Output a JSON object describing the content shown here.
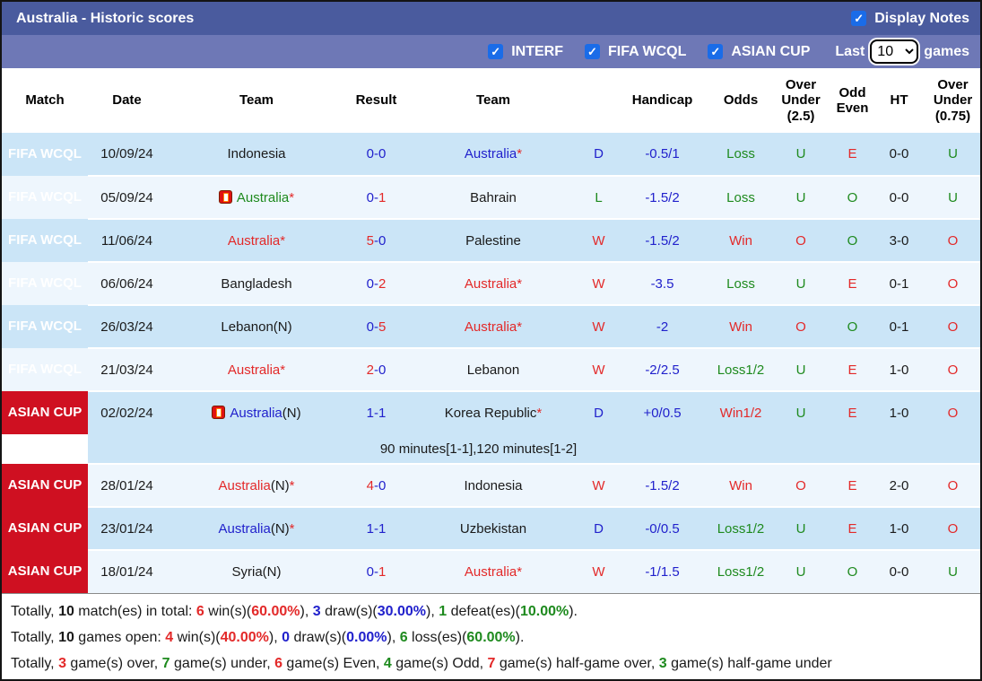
{
  "palette": {
    "red": "#e32929",
    "green": "#1e8a1e",
    "blue": "#2121cc",
    "black": "#1a1a1a"
  },
  "title_bar": {
    "title": "Australia - Historic scores",
    "display_notes": "Display Notes"
  },
  "filter_bar": {
    "interf": "INTERF",
    "fifa": "FIFA WCQL",
    "asian": "ASIAN CUP",
    "last": "Last",
    "games": "games",
    "count": "10"
  },
  "table": {
    "headers": [
      "Match",
      "Date",
      "Team",
      "Result",
      "Team",
      "",
      "Handicap",
      "Odds",
      "Over Under (2.5)",
      "Odd Even",
      "HT",
      "Over Under (0.75)"
    ],
    "rows": [
      {
        "comp": "FIFA WCQL",
        "compClass": "fifa",
        "shade": "dark",
        "date": "10/09/24",
        "t1": {
          "icon": false,
          "seg": [
            [
              "Indonesia",
              "black"
            ]
          ]
        },
        "res": [
          [
            "0",
            "blue"
          ],
          [
            "-",
            "blue"
          ],
          [
            "0",
            "blue"
          ]
        ],
        "t2": {
          "icon": false,
          "seg": [
            [
              "Australia",
              "blue"
            ],
            [
              "*",
              "red"
            ]
          ]
        },
        "wdl": [
          [
            "D",
            "blue"
          ]
        ],
        "hcp": [
          [
            "-0.5/1",
            "blue"
          ]
        ],
        "odds": [
          [
            "Loss",
            "green"
          ]
        ],
        "ou25": [
          [
            "U",
            "green"
          ]
        ],
        "oe": [
          [
            "E",
            "red"
          ]
        ],
        "ht": [
          [
            "0-0",
            "black"
          ]
        ],
        "ou075": [
          [
            "U",
            "green"
          ]
        ]
      },
      {
        "comp": "FIFA WCQL",
        "compClass": "fifa",
        "shade": "light",
        "date": "05/09/24",
        "t1": {
          "icon": true,
          "seg": [
            [
              "Australia",
              "green"
            ],
            [
              "*",
              "red"
            ]
          ]
        },
        "res": [
          [
            "0",
            "blue"
          ],
          [
            "-",
            "blue"
          ],
          [
            "1",
            "red"
          ]
        ],
        "t2": {
          "icon": false,
          "seg": [
            [
              "Bahrain",
              "black"
            ]
          ]
        },
        "wdl": [
          [
            "L",
            "green"
          ]
        ],
        "hcp": [
          [
            "-1.5/2",
            "blue"
          ]
        ],
        "odds": [
          [
            "Loss",
            "green"
          ]
        ],
        "ou25": [
          [
            "U",
            "green"
          ]
        ],
        "oe": [
          [
            "O",
            "green"
          ]
        ],
        "ht": [
          [
            "0-0",
            "black"
          ]
        ],
        "ou075": [
          [
            "U",
            "green"
          ]
        ]
      },
      {
        "comp": "FIFA WCQL",
        "compClass": "fifa",
        "shade": "dark",
        "date": "11/06/24",
        "t1": {
          "icon": false,
          "seg": [
            [
              "Australia",
              "red"
            ],
            [
              "*",
              "red"
            ]
          ]
        },
        "res": [
          [
            "5",
            "red"
          ],
          [
            "-",
            "blue"
          ],
          [
            "0",
            "blue"
          ]
        ],
        "t2": {
          "icon": false,
          "seg": [
            [
              "Palestine",
              "black"
            ]
          ]
        },
        "wdl": [
          [
            "W",
            "red"
          ]
        ],
        "hcp": [
          [
            "-1.5/2",
            "blue"
          ]
        ],
        "odds": [
          [
            "Win",
            "red"
          ]
        ],
        "ou25": [
          [
            "O",
            "red"
          ]
        ],
        "oe": [
          [
            "O",
            "green"
          ]
        ],
        "ht": [
          [
            "3-0",
            "black"
          ]
        ],
        "ou075": [
          [
            "O",
            "red"
          ]
        ]
      },
      {
        "comp": "FIFA WCQL",
        "compClass": "fifa",
        "shade": "light",
        "date": "06/06/24",
        "t1": {
          "icon": false,
          "seg": [
            [
              "Bangladesh",
              "black"
            ]
          ]
        },
        "res": [
          [
            "0",
            "blue"
          ],
          [
            "-",
            "blue"
          ],
          [
            "2",
            "red"
          ]
        ],
        "t2": {
          "icon": false,
          "seg": [
            [
              "Australia",
              "red"
            ],
            [
              "*",
              "red"
            ]
          ]
        },
        "wdl": [
          [
            "W",
            "red"
          ]
        ],
        "hcp": [
          [
            "-3.5",
            "blue"
          ]
        ],
        "odds": [
          [
            "Loss",
            "green"
          ]
        ],
        "ou25": [
          [
            "U",
            "green"
          ]
        ],
        "oe": [
          [
            "E",
            "red"
          ]
        ],
        "ht": [
          [
            "0-1",
            "black"
          ]
        ],
        "ou075": [
          [
            "O",
            "red"
          ]
        ]
      },
      {
        "comp": "FIFA WCQL",
        "compClass": "fifa",
        "shade": "dark",
        "date": "26/03/24",
        "t1": {
          "icon": false,
          "seg": [
            [
              "Lebanon(N)",
              "black"
            ]
          ]
        },
        "res": [
          [
            "0",
            "blue"
          ],
          [
            "-",
            "blue"
          ],
          [
            "5",
            "red"
          ]
        ],
        "t2": {
          "icon": false,
          "seg": [
            [
              "Australia",
              "red"
            ],
            [
              "*",
              "red"
            ]
          ]
        },
        "wdl": [
          [
            "W",
            "red"
          ]
        ],
        "hcp": [
          [
            "-2",
            "blue"
          ]
        ],
        "odds": [
          [
            "Win",
            "red"
          ]
        ],
        "ou25": [
          [
            "O",
            "red"
          ]
        ],
        "oe": [
          [
            "O",
            "green"
          ]
        ],
        "ht": [
          [
            "0-1",
            "black"
          ]
        ],
        "ou075": [
          [
            "O",
            "red"
          ]
        ]
      },
      {
        "comp": "FIFA WCQL",
        "compClass": "fifa",
        "shade": "light",
        "date": "21/03/24",
        "t1": {
          "icon": false,
          "seg": [
            [
              "Australia",
              "red"
            ],
            [
              "*",
              "red"
            ]
          ]
        },
        "res": [
          [
            "2",
            "red"
          ],
          [
            "-",
            "blue"
          ],
          [
            "0",
            "blue"
          ]
        ],
        "t2": {
          "icon": false,
          "seg": [
            [
              "Lebanon",
              "black"
            ]
          ]
        },
        "wdl": [
          [
            "W",
            "red"
          ]
        ],
        "hcp": [
          [
            "-2/2.5",
            "blue"
          ]
        ],
        "odds": [
          [
            "Loss1/2",
            "green"
          ]
        ],
        "ou25": [
          [
            "U",
            "green"
          ]
        ],
        "oe": [
          [
            "E",
            "red"
          ]
        ],
        "ht": [
          [
            "1-0",
            "black"
          ]
        ],
        "ou075": [
          [
            "O",
            "red"
          ]
        ]
      },
      {
        "comp": "ASIAN CUP",
        "compClass": "asian",
        "shade": "dark",
        "date": "02/02/24",
        "t1": {
          "icon": true,
          "seg": [
            [
              "Australia",
              "blue"
            ],
            [
              "(N)",
              "black"
            ]
          ]
        },
        "res": [
          [
            "1",
            "blue"
          ],
          [
            "-",
            "blue"
          ],
          [
            "1",
            "blue"
          ]
        ],
        "t2": {
          "icon": false,
          "seg": [
            [
              "Korea Republic",
              "black"
            ],
            [
              "*",
              "red"
            ]
          ]
        },
        "wdl": [
          [
            "D",
            "blue"
          ]
        ],
        "hcp": [
          [
            "+0/0.5",
            "blue"
          ]
        ],
        "odds": [
          [
            "Win1/2",
            "red"
          ]
        ],
        "ou25": [
          [
            "U",
            "green"
          ]
        ],
        "oe": [
          [
            "E",
            "red"
          ]
        ],
        "ht": [
          [
            "1-0",
            "black"
          ]
        ],
        "ou075": [
          [
            "O",
            "red"
          ]
        ],
        "note": "90 minutes[1-1],120 minutes[1-2]"
      },
      {
        "comp": "ASIAN CUP",
        "compClass": "asian",
        "shade": "light",
        "date": "28/01/24",
        "t1": {
          "icon": false,
          "seg": [
            [
              "Australia",
              "red"
            ],
            [
              "(N)",
              "black"
            ],
            [
              "*",
              "red"
            ]
          ]
        },
        "res": [
          [
            "4",
            "red"
          ],
          [
            "-",
            "blue"
          ],
          [
            "0",
            "blue"
          ]
        ],
        "t2": {
          "icon": false,
          "seg": [
            [
              "Indonesia",
              "black"
            ]
          ]
        },
        "wdl": [
          [
            "W",
            "red"
          ]
        ],
        "hcp": [
          [
            "-1.5/2",
            "blue"
          ]
        ],
        "odds": [
          [
            "Win",
            "red"
          ]
        ],
        "ou25": [
          [
            "O",
            "red"
          ]
        ],
        "oe": [
          [
            "E",
            "red"
          ]
        ],
        "ht": [
          [
            "2-0",
            "black"
          ]
        ],
        "ou075": [
          [
            "O",
            "red"
          ]
        ]
      },
      {
        "comp": "ASIAN CUP",
        "compClass": "asian",
        "shade": "dark",
        "date": "23/01/24",
        "t1": {
          "icon": false,
          "seg": [
            [
              "Australia",
              "blue"
            ],
            [
              "(N)",
              "black"
            ],
            [
              "*",
              "red"
            ]
          ]
        },
        "res": [
          [
            "1",
            "blue"
          ],
          [
            "-",
            "blue"
          ],
          [
            "1",
            "blue"
          ]
        ],
        "t2": {
          "icon": false,
          "seg": [
            [
              "Uzbekistan",
              "black"
            ]
          ]
        },
        "wdl": [
          [
            "D",
            "blue"
          ]
        ],
        "hcp": [
          [
            "-0/0.5",
            "blue"
          ]
        ],
        "odds": [
          [
            "Loss1/2",
            "green"
          ]
        ],
        "ou25": [
          [
            "U",
            "green"
          ]
        ],
        "oe": [
          [
            "E",
            "red"
          ]
        ],
        "ht": [
          [
            "1-0",
            "black"
          ]
        ],
        "ou075": [
          [
            "O",
            "red"
          ]
        ]
      },
      {
        "comp": "ASIAN CUP",
        "compClass": "asian",
        "shade": "light",
        "date": "18/01/24",
        "t1": {
          "icon": false,
          "seg": [
            [
              "Syria(N)",
              "black"
            ]
          ]
        },
        "res": [
          [
            "0",
            "blue"
          ],
          [
            "-",
            "blue"
          ],
          [
            "1",
            "red"
          ]
        ],
        "t2": {
          "icon": false,
          "seg": [
            [
              "Australia",
              "red"
            ],
            [
              "*",
              "red"
            ]
          ]
        },
        "wdl": [
          [
            "W",
            "red"
          ]
        ],
        "hcp": [
          [
            "-1/1.5",
            "blue"
          ]
        ],
        "odds": [
          [
            "Loss1/2",
            "green"
          ]
        ],
        "ou25": [
          [
            "U",
            "green"
          ]
        ],
        "oe": [
          [
            "O",
            "green"
          ]
        ],
        "ht": [
          [
            "0-0",
            "black"
          ]
        ],
        "ou075": [
          [
            "U",
            "green"
          ]
        ]
      }
    ]
  },
  "footer": {
    "lines": [
      [
        [
          "Totally, ",
          "black",
          0
        ],
        [
          "10",
          "black",
          1
        ],
        [
          " match(es) in total: ",
          "black",
          0
        ],
        [
          "6",
          "red",
          1
        ],
        [
          " win(s)(",
          "black",
          0
        ],
        [
          "60.00%",
          "red",
          1
        ],
        [
          "), ",
          "black",
          0
        ],
        [
          "3",
          "blue",
          1
        ],
        [
          " draw(s)(",
          "black",
          0
        ],
        [
          "30.00%",
          "blue",
          1
        ],
        [
          "), ",
          "black",
          0
        ],
        [
          "1",
          "green",
          1
        ],
        [
          " defeat(es)(",
          "black",
          0
        ],
        [
          "10.00%",
          "green",
          1
        ],
        [
          ").",
          "black",
          0
        ]
      ],
      [
        [
          "Totally, ",
          "black",
          0
        ],
        [
          "10",
          "black",
          1
        ],
        [
          " games open: ",
          "black",
          0
        ],
        [
          "4",
          "red",
          1
        ],
        [
          " win(s)(",
          "black",
          0
        ],
        [
          "40.00%",
          "red",
          1
        ],
        [
          "), ",
          "black",
          0
        ],
        [
          "0",
          "blue",
          1
        ],
        [
          " draw(s)(",
          "black",
          0
        ],
        [
          "0.00%",
          "blue",
          1
        ],
        [
          "), ",
          "black",
          0
        ],
        [
          "6",
          "green",
          1
        ],
        [
          " loss(es)(",
          "black",
          0
        ],
        [
          "60.00%",
          "green",
          1
        ],
        [
          ").",
          "black",
          0
        ]
      ],
      [
        [
          "Totally, ",
          "black",
          0
        ],
        [
          "3",
          "red",
          1
        ],
        [
          " game(s) over, ",
          "black",
          0
        ],
        [
          "7",
          "green",
          1
        ],
        [
          " game(s) under, ",
          "black",
          0
        ],
        [
          "6",
          "red",
          1
        ],
        [
          " game(s) Even, ",
          "black",
          0
        ],
        [
          "4",
          "green",
          1
        ],
        [
          " game(s) Odd, ",
          "black",
          0
        ],
        [
          "7",
          "red",
          1
        ],
        [
          " game(s) half-game over, ",
          "black",
          0
        ],
        [
          "3",
          "green",
          1
        ],
        [
          " game(s) half-game under",
          "black",
          0
        ]
      ]
    ]
  }
}
